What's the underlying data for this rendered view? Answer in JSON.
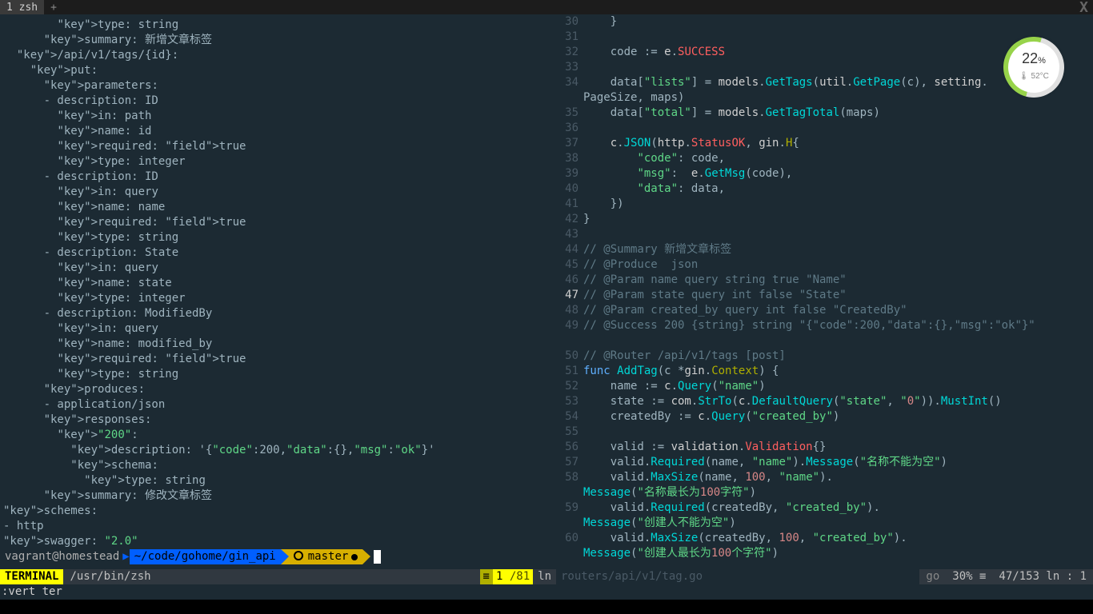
{
  "tabs": {
    "t1": "1 zsh",
    "plus": "+"
  },
  "close": "X",
  "widget": {
    "pct": "22",
    "pctUnit": "%",
    "temp": "🌡 52°C"
  },
  "left": {
    "lines": "        type: string\n      summary: 新增文章标签\n  /api/v1/tags/{id}:\n    put:\n      parameters:\n      - description: ID\n        in: path\n        name: id\n        required: true\n        type: integer\n      - description: ID\n        in: query\n        name: name\n        required: true\n        type: string\n      - description: State\n        in: query\n        name: state\n        type: integer\n      - description: ModifiedBy\n        in: query\n        name: modified_by\n        required: true\n        type: string\n      produces:\n      - application/json\n      responses:\n        \"200\":\n          description: '{\"code\":200,\"data\":{},\"msg\":\"ok\"}'\n          schema:\n            type: string\n      summary: 修改文章标签\nschemes:\n- http\nswagger: \"2.0\""
  },
  "right": {
    "startLine": 30,
    "currentLine": 47,
    "code": [
      {
        "n": 30,
        "txt": "    }"
      },
      {
        "n": 31,
        "txt": ""
      },
      {
        "n": 32,
        "txt": "    code := e.SUCCESS",
        "hl": [
          [
            "code",
            "id"
          ],
          [
            " := ",
            "op"
          ],
          [
            "e",
            "id"
          ],
          [
            ".",
            "op"
          ],
          [
            "SUCCESS",
            "field"
          ]
        ]
      },
      {
        "n": 33,
        "txt": ""
      },
      {
        "n": 34,
        "txt": "    data[\"lists\"] = models.GetTags(util.GetPage(c), setting."
      },
      {
        "n": 0,
        "cont": "PageSize, maps)"
      },
      {
        "n": 35,
        "txt": "    data[\"total\"] = models.GetTagTotal(maps)"
      },
      {
        "n": 36,
        "txt": ""
      },
      {
        "n": 37,
        "txt": "    c.JSON(http.StatusOK, gin.H{"
      },
      {
        "n": 38,
        "txt": "        \"code\": code,"
      },
      {
        "n": 39,
        "txt": "        \"msg\":  e.GetMsg(code),"
      },
      {
        "n": 40,
        "txt": "        \"data\": data,"
      },
      {
        "n": 41,
        "txt": "    })"
      },
      {
        "n": 42,
        "txt": "}"
      },
      {
        "n": 43,
        "txt": ""
      },
      {
        "n": 44,
        "txt": "// @Summary 新增文章标签",
        "c": true
      },
      {
        "n": 45,
        "txt": "// @Produce  json",
        "c": true
      },
      {
        "n": 46,
        "txt": "// @Param name query string true \"Name\"",
        "c": true
      },
      {
        "n": 47,
        "txt": "// @Param state query int false \"State\"",
        "c": true
      },
      {
        "n": 48,
        "txt": "// @Param created_by query int false \"CreatedBy\"",
        "c": true
      },
      {
        "n": 49,
        "txt": "// @Success 200 {string} string \"{\"code\":200,\"data\":{},\"msg\":\"ok\"}\"",
        "c": true
      },
      {
        "n": 0,
        "cont": "",
        "c": true
      },
      {
        "n": 50,
        "txt": "// @Router /api/v1/tags [post]",
        "c": true
      },
      {
        "n": 51,
        "txt": "func AddTag(c *gin.Context) {"
      },
      {
        "n": 52,
        "txt": "    name := c.Query(\"name\")"
      },
      {
        "n": 53,
        "txt": "    state := com.StrTo(c.DefaultQuery(\"state\", \"0\")).MustInt()"
      },
      {
        "n": 54,
        "txt": "    createdBy := c.Query(\"created_by\")"
      },
      {
        "n": 55,
        "txt": ""
      },
      {
        "n": 56,
        "txt": "    valid := validation.Validation{}"
      },
      {
        "n": 57,
        "txt": "    valid.Required(name, \"name\").Message(\"名称不能为空\")"
      },
      {
        "n": 58,
        "txt": "    valid.MaxSize(name, 100, \"name\")."
      },
      {
        "n": 0,
        "cont": "Message(\"名称最长为100字符\")"
      },
      {
        "n": 59,
        "txt": "    valid.Required(createdBy, \"created_by\")."
      },
      {
        "n": 0,
        "cont": "Message(\"创建人不能为空\")"
      },
      {
        "n": 60,
        "txt": "    valid.MaxSize(createdBy, 100, \"created_by\")."
      },
      {
        "n": 0,
        "cont": "Message(\"创建人最长为100个字符\")"
      }
    ]
  },
  "prompt": {
    "userhost": "vagrant@homestead",
    "cwd": "~/code/gohome/gin_api",
    "branch": "master"
  },
  "statusL": {
    "mode": " TERMINAL ",
    "path": "/usr/bin/zsh",
    "hamb": "≡",
    "pos": "1",
    "total": "/81",
    "ln": "ln"
  },
  "statusR": {
    "file": "routers/api/v1/tag.go",
    "ft": "go",
    "pct": "30% ≡",
    "rc": "47/153 ln : 1"
  },
  "cmdline": ":vert ter"
}
